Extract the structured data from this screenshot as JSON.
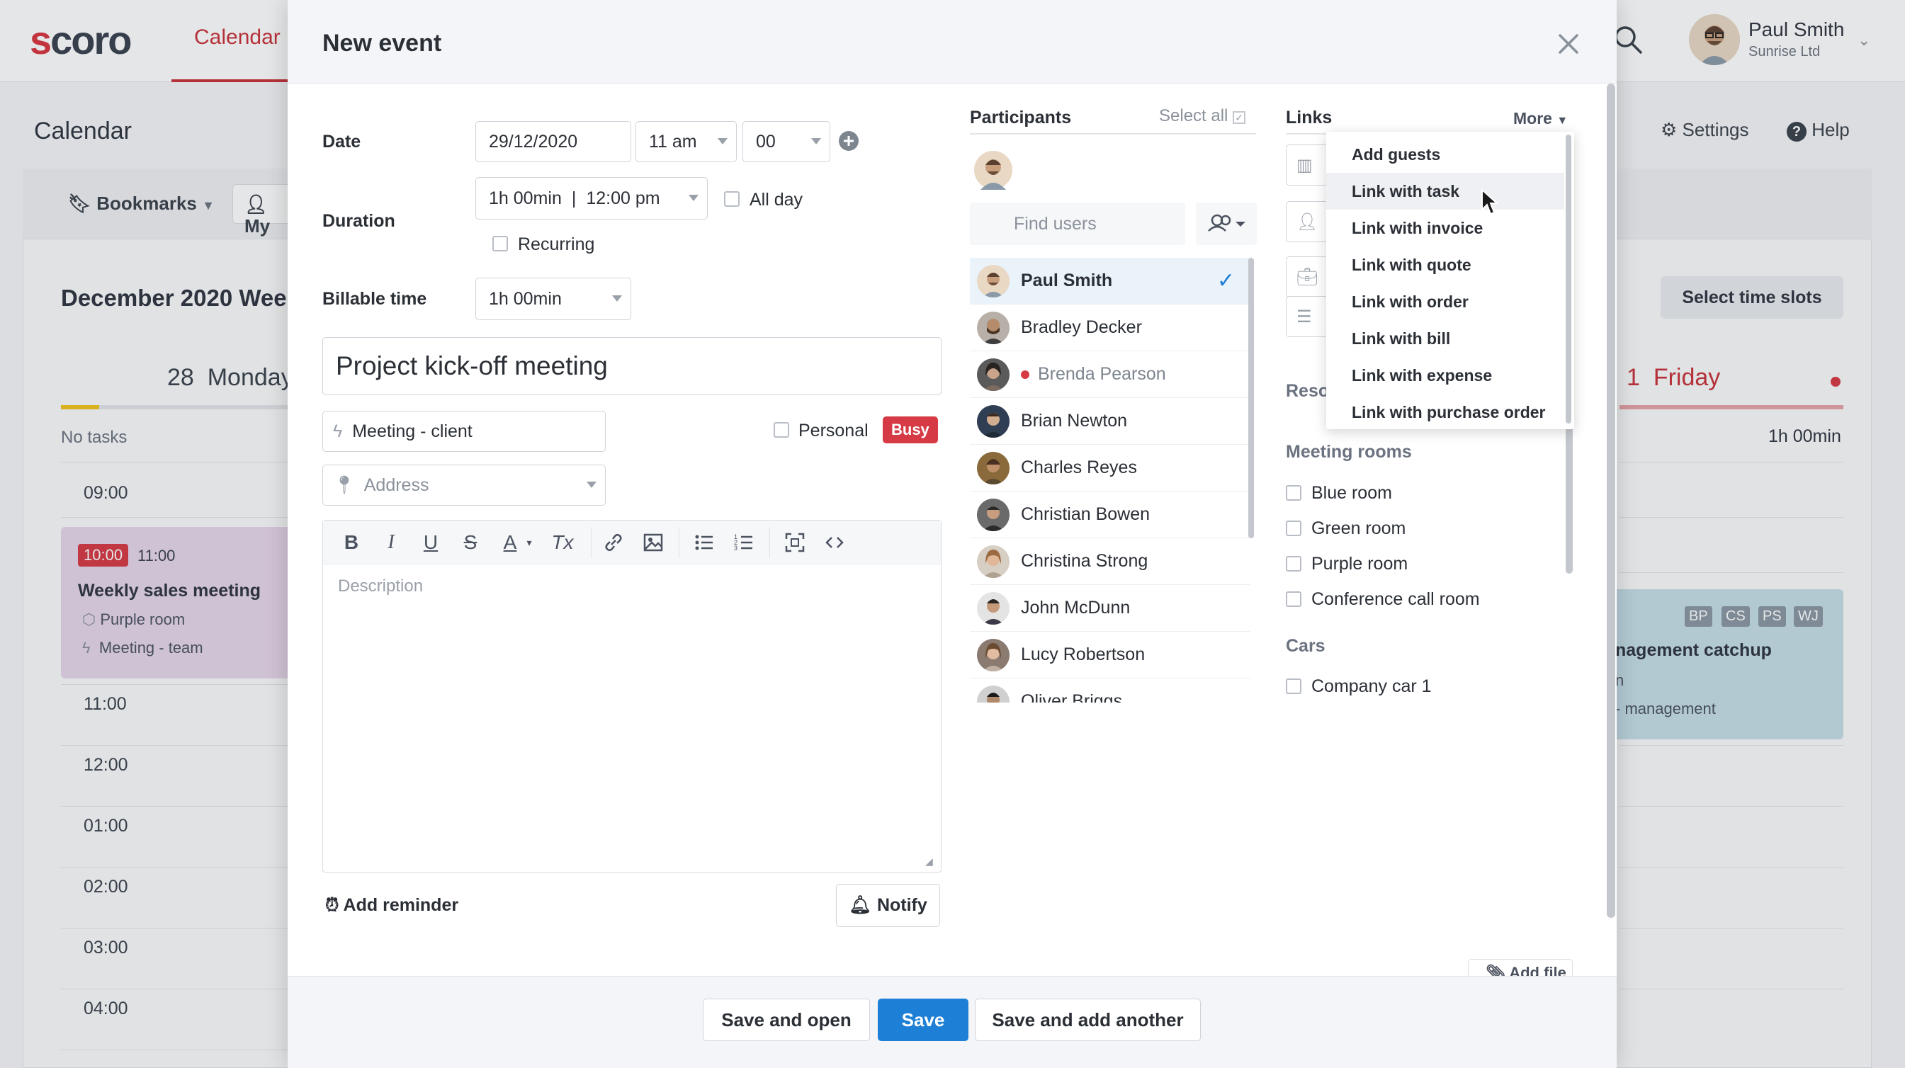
{
  "app": {
    "logo_text": "scoro",
    "nav_active": "Calendar",
    "user": {
      "name": "Paul Smith",
      "company": "Sunrise Ltd"
    },
    "page_title": "Calendar",
    "settings_label": "Settings",
    "help_label": "Help",
    "bookmarks_label": "Bookmarks",
    "my_label": "My",
    "month_title": "December 2020 Wee",
    "select_slots_label": "Select time slots",
    "monday": {
      "num": "28",
      "name": "Monday"
    },
    "no_tasks": "No tasks",
    "times": [
      "09:00",
      "11:00",
      "12:00",
      "01:00",
      "02:00",
      "03:00",
      "04:00"
    ],
    "event_left": {
      "start": "10:00",
      "end": "11:00",
      "title": "Weekly sales meeting",
      "room": "Purple room",
      "type": "Meeting - team"
    },
    "friday": {
      "num": "1",
      "name": "Friday",
      "duration": "1h 00min"
    },
    "event_right": {
      "initials": [
        "BP",
        "CS",
        "PS",
        "WJ"
      ],
      "title": "nagement catchup",
      "line2": "n",
      "type": "- management"
    }
  },
  "modal": {
    "title": "New event",
    "date_label": "Date",
    "date_value": "29/12/2020",
    "hour_value": "11 am",
    "minute_value": "00",
    "duration_label": "Duration",
    "duration_value": "1h 00min",
    "end_time_value": "12:00 pm",
    "all_day_label": "All day",
    "recurring_label": "Recurring",
    "billable_label": "Billable time",
    "billable_value": "1h 00min",
    "event_title": "Project kick-off meeting",
    "event_type": "Meeting - client",
    "personal_label": "Personal",
    "busy_label": "Busy",
    "address_placeholder": "Address",
    "description_placeholder": "Description",
    "add_reminder_label": "Add reminder",
    "notify_label": "Notify"
  },
  "participants": {
    "title": "Participants",
    "select_all": "Select all",
    "search_placeholder": "Find users",
    "users": [
      {
        "name": "Paul Smith",
        "selected": true
      },
      {
        "name": "Bradley Decker"
      },
      {
        "name": "Brenda Pearson",
        "status": "busy"
      },
      {
        "name": "Brian Newton"
      },
      {
        "name": "Charles Reyes"
      },
      {
        "name": "Christian Bowen"
      },
      {
        "name": "Christina Strong"
      },
      {
        "name": "John McDunn"
      },
      {
        "name": "Lucy Robertson"
      },
      {
        "name": "Oliver Briggs"
      }
    ]
  },
  "links": {
    "title": "Links",
    "more_label": "More",
    "menu": [
      "Add guests",
      "Link with task",
      "Link with invoice",
      "Link with quote",
      "Link with order",
      "Link with bill",
      "Link with expense",
      "Link with purchase order"
    ],
    "highlighted": "Link with task",
    "resources_label": "Reso",
    "meeting_rooms_title": "Meeting rooms",
    "rooms": [
      "Blue room",
      "Green room",
      "Purple room",
      "Conference call room"
    ],
    "cars_title": "Cars",
    "cars": [
      "Company car 1"
    ],
    "add_file_label": "Add file"
  },
  "footer": {
    "save_open": "Save and open",
    "save": "Save",
    "save_add": "Save and add another"
  },
  "colors": {
    "accent": "#1d7fd6",
    "brand_red": "#c9323b",
    "busy": "#d63a45"
  }
}
